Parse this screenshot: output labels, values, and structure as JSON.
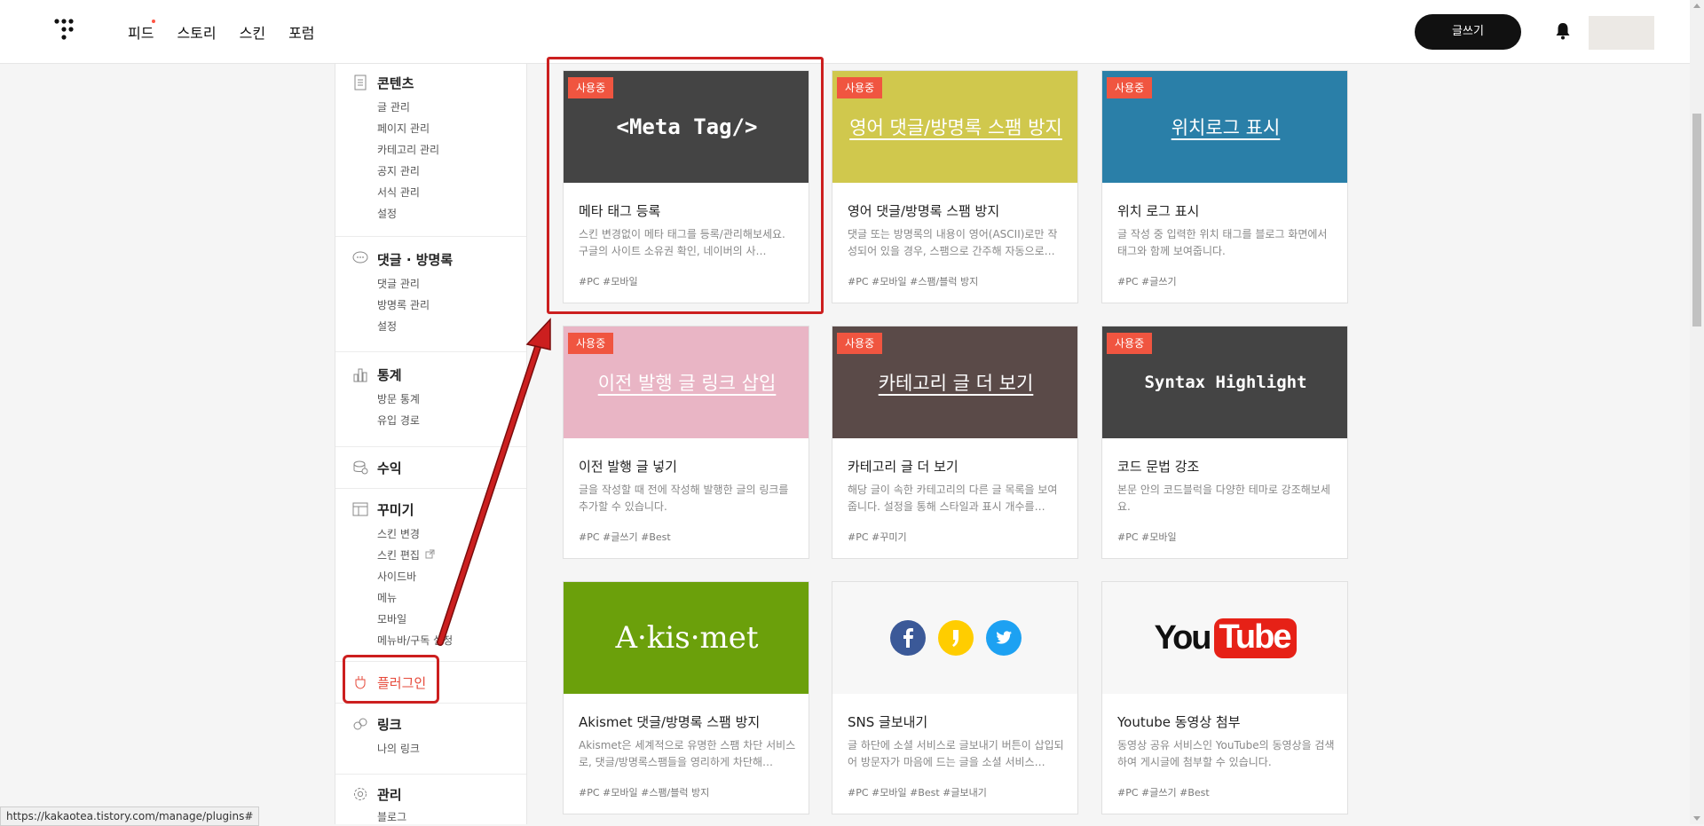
{
  "header": {
    "nav": [
      "피드",
      "스토리",
      "스킨",
      "포럼"
    ],
    "write_label": "글쓰기"
  },
  "sidebar": {
    "content": {
      "title": "콘텐츠",
      "items": [
        "글 관리",
        "페이지 관리",
        "카테고리 관리",
        "공지 관리",
        "서식 관리",
        "설정"
      ]
    },
    "comments": {
      "title": "댓글 · 방명록",
      "items": [
        "댓글 관리",
        "방명록 관리",
        "설정"
      ]
    },
    "stats": {
      "title": "통계",
      "items": [
        "방문 통계",
        "유입 경로"
      ]
    },
    "revenue": {
      "title": "수익"
    },
    "decorate": {
      "title": "꾸미기",
      "items": [
        "스킨 변경",
        "스킨 편집",
        "사이드바",
        "메뉴",
        "모바일",
        "메뉴바/구독 설정"
      ]
    },
    "plugin": {
      "title": "플러그인"
    },
    "link": {
      "title": "링크",
      "items": [
        "나의 링크"
      ]
    },
    "manage": {
      "title": "관리",
      "items": [
        "블로그"
      ]
    }
  },
  "cards": [
    {
      "badge": "사용중",
      "thumb_text": "<Meta Tag/>",
      "title": "메타 태그 등록",
      "desc": "스킨 변경없이 메타 태그를 등록/관리해보세요. 구글의 사이트 소유권 확인, 네이버의 사…",
      "tags": "#PC   #모바일"
    },
    {
      "badge": "사용중",
      "thumb_text": "영어 댓글/방명록 스팸 방지",
      "title": "영어 댓글/방명록 스팸 방지",
      "desc": "댓글 또는 방명록의 내용이 영어(ASCII)로만 작성되어 있을 경우, 스팸으로 간주해 자동으로…",
      "tags": "#PC   #모바일   #스팸/블럭 방지"
    },
    {
      "badge": "사용중",
      "thumb_text": "위치로그 표시",
      "title": "위치 로그 표시",
      "desc": "글 작성 중 입력한 위치 태그를 블로그 화면에서 태그와 함께 보여줍니다.",
      "tags": "#PC   #글쓰기"
    },
    {
      "badge": "사용중",
      "thumb_text": "이전 발행 글 링크 삽입",
      "title": "이전 발행 글 넣기",
      "desc": "글을 작성할 때 전에 작성해 발행한 글의 링크를 추가할 수 있습니다.",
      "tags": "#PC   #글쓰기   #Best"
    },
    {
      "badge": "사용중",
      "thumb_text": "카테고리 글 더 보기",
      "title": "카테고리 글 더 보기",
      "desc": "해당 글이 속한 카테고리의 다른 글 목록을 보여줍니다. 설정을 통해 스타일과 표시 개수를…",
      "tags": "#PC   #꾸미기"
    },
    {
      "badge": "사용중",
      "thumb_text": "Syntax Highlight",
      "title": "코드 문법 강조",
      "desc": "본문 안의 코드블럭을 다양한 테마로 강조해보세요.",
      "tags": "#PC   #모바일"
    },
    {
      "badge": "",
      "thumb_text": "A·kis·met",
      "title": "Akismet 댓글/방명록 스팸 방지",
      "desc": "Akismet은 세계적으로 유명한 스팸 차단 서비스로, 댓글/방명록스팸들을 영리하게 차단해…",
      "tags": "#PC   #모바일   #스팸/블럭 방지"
    },
    {
      "badge": "",
      "thumb_text": "",
      "title": "SNS 글보내기",
      "desc": "글 하단에 소셜 서비스로 글보내기 버튼이 삽입되어 방문자가 마음에 드는 글을 소셜 서비스…",
      "tags": "#PC   #모바일   #Best   #글보내기"
    },
    {
      "badge": "",
      "thumb_text": "",
      "title": "Youtube 동영상 첨부",
      "desc": "동영상 공유 서비스인 YouTube의 동영상을 검색하여 게시글에 첨부할 수 있습니다.",
      "tags": "#PC   #글쓰기   #Best"
    }
  ],
  "youtube": {
    "you": "You",
    "tube": "Tube"
  },
  "status_url": "https://kakaotea.tistory.com/manage/plugins#",
  "colors": {
    "accent": "#f05540",
    "annotation": "#cc1f1f"
  }
}
